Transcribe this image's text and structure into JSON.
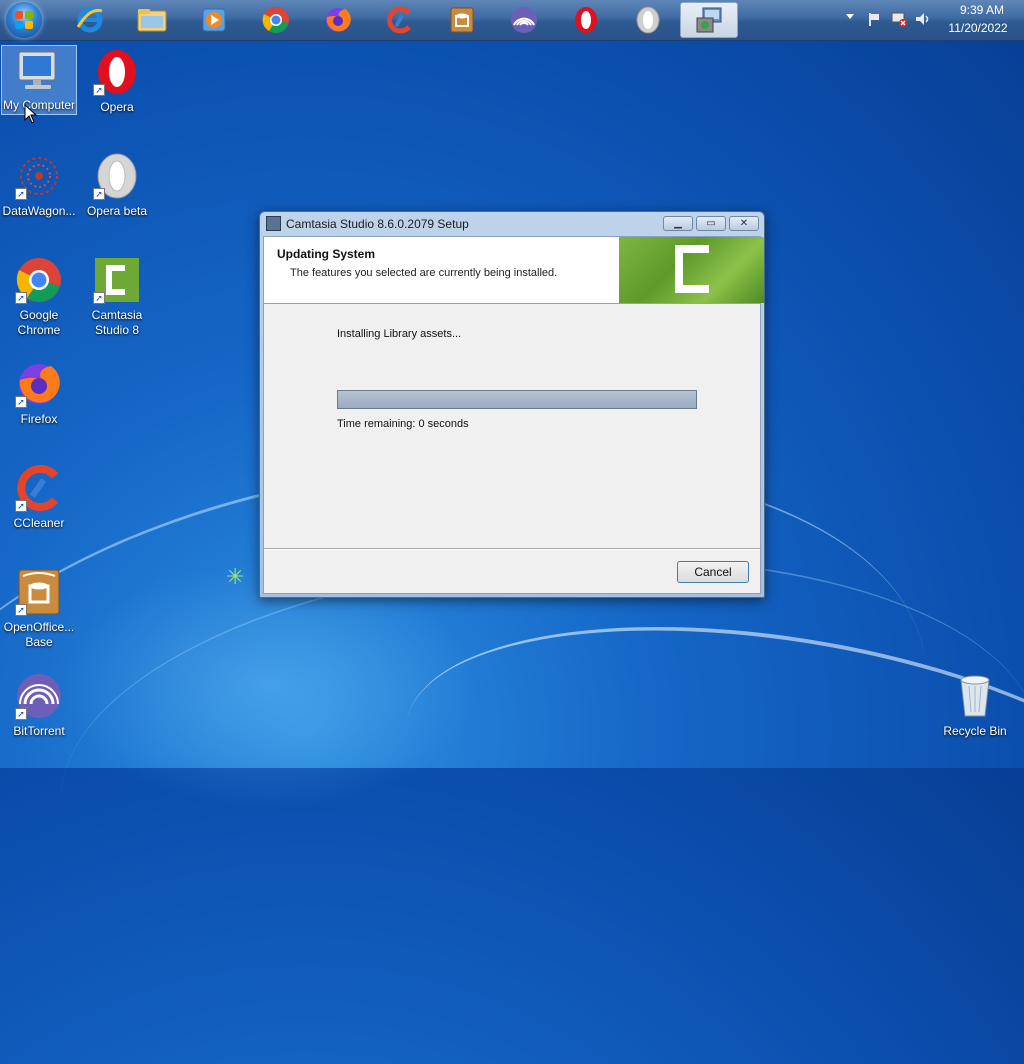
{
  "taskbar": {
    "pinned": [
      {
        "name": "internet-explorer-icon"
      },
      {
        "name": "file-explorer-icon"
      },
      {
        "name": "media-player-icon"
      },
      {
        "name": "chrome-icon"
      },
      {
        "name": "firefox-icon"
      },
      {
        "name": "ccleaner-icon"
      },
      {
        "name": "openoffice-base-icon"
      },
      {
        "name": "bittorrent-icon"
      },
      {
        "name": "opera-icon"
      },
      {
        "name": "opera-beta-icon"
      },
      {
        "name": "setup-installer-icon",
        "active": true
      }
    ],
    "clock": {
      "time": "9:39 AM",
      "date": "11/20/2022"
    }
  },
  "desktop": {
    "icons": [
      {
        "label": "My Computer",
        "icon": "computer-icon"
      },
      {
        "label": "Opera",
        "icon": "opera-icon"
      },
      {
        "label": "DataWagon...",
        "icon": "datawagon-icon"
      },
      {
        "label": "Opera beta",
        "icon": "opera-beta-icon"
      },
      {
        "label": "Google Chrome",
        "icon": "chrome-icon"
      },
      {
        "label": "Camtasia Studio 8",
        "icon": "camtasia-icon"
      },
      {
        "label": "Firefox",
        "icon": "firefox-icon"
      },
      {
        "label": "CCleaner",
        "icon": "ccleaner-icon"
      },
      {
        "label": "OpenOffice... Base",
        "icon": "openoffice-base-icon"
      },
      {
        "label": "BitTorrent",
        "icon": "bittorrent-icon"
      },
      {
        "label": "Recycle Bin",
        "icon": "recycle-bin-icon"
      }
    ]
  },
  "dialog": {
    "title": "Camtasia Studio 8.6.0.2079 Setup",
    "header_title": "Updating System",
    "header_subtitle": "The features you selected are currently being installed.",
    "status": "Installing Library assets...",
    "progress_fraction": 1.0,
    "time_remaining": "Time remaining: 0 seconds",
    "cancel_label": "Cancel"
  },
  "colors": {
    "desktop_blue": "#1566c6",
    "taskbar": "#3e6aa2",
    "camtasia_green": "#6fa935",
    "progress_fill": "#a8b8cc"
  }
}
